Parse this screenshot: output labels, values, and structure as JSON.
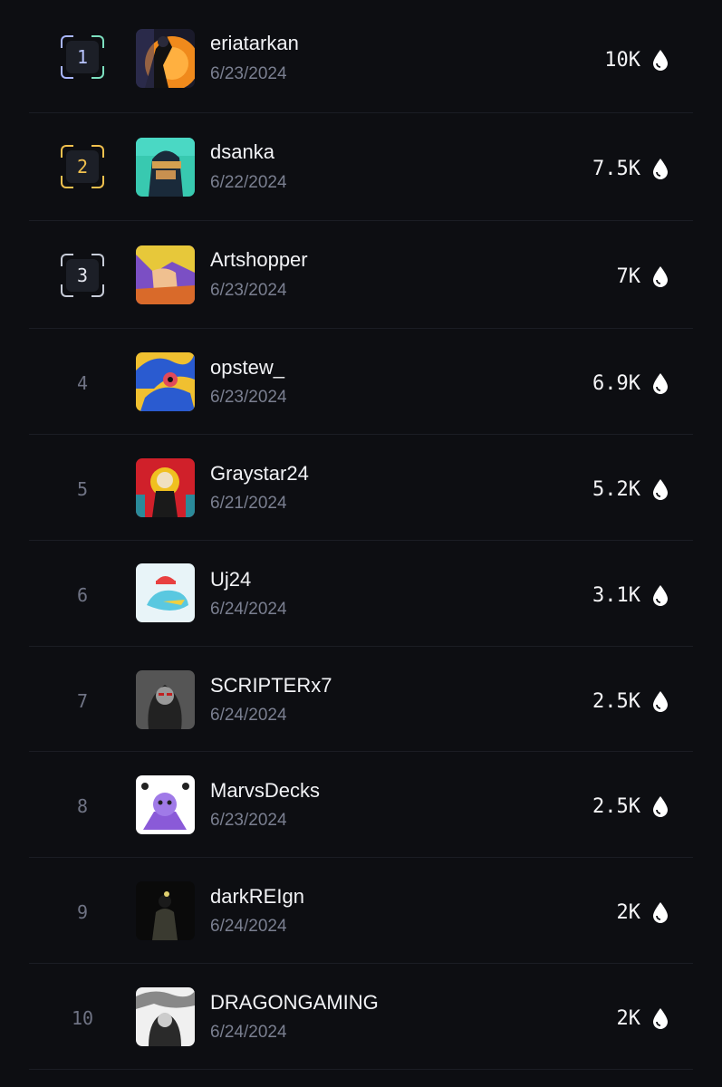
{
  "leaderboard": {
    "entries": [
      {
        "rank": "1",
        "name": "eriatarkan",
        "date": "6/23/2024",
        "score": "10K",
        "badge_color": "#a9b6ff",
        "badge_color2": "#7de0c0",
        "avatar": [
          "#f08a1c",
          "#1a1a2a",
          "#e8c060"
        ]
      },
      {
        "rank": "2",
        "name": "dsanka",
        "date": "6/22/2024",
        "score": "7.5K",
        "badge_color": "#f2c14e",
        "badge_color2": "#f2c14e",
        "avatar": [
          "#38c9b0",
          "#1a2a3a",
          "#d4a050"
        ]
      },
      {
        "rank": "3",
        "name": "Artshopper",
        "date": "6/23/2024",
        "score": "7K",
        "badge_color": "#c7ccd8",
        "badge_color2": "#c7ccd8",
        "avatar": [
          "#e7c83a",
          "#7b4fc4",
          "#d96a2a"
        ]
      },
      {
        "rank": "4",
        "name": "opstew_",
        "date": "6/23/2024",
        "score": "6.9K",
        "avatar": [
          "#f0c030",
          "#2a5bd0",
          "#e04a5a"
        ]
      },
      {
        "rank": "5",
        "name": "Graystar24",
        "date": "6/21/2024",
        "score": "5.2K",
        "avatar": [
          "#d0202a",
          "#1a1a1a",
          "#f0e0c0"
        ]
      },
      {
        "rank": "6",
        "name": "Uj24",
        "date": "6/24/2024",
        "score": "3.1K",
        "avatar": [
          "#e8f4f8",
          "#5ac8e0",
          "#e84040"
        ]
      },
      {
        "rank": "7",
        "name": "SCRIPTERx7",
        "date": "6/24/2024",
        "score": "2.5K",
        "avatar": [
          "#555555",
          "#222222",
          "#999999"
        ]
      },
      {
        "rank": "8",
        "name": "MarvsDecks",
        "date": "6/23/2024",
        "score": "2.5K",
        "avatar": [
          "#ffffff",
          "#8a5ad8",
          "#222222"
        ]
      },
      {
        "rank": "9",
        "name": "darkREIgn",
        "date": "6/24/2024",
        "score": "2K",
        "avatar": [
          "#0a0a0a",
          "#3a3a30",
          "#e0d070"
        ]
      },
      {
        "rank": "10",
        "name": "DRAGONGAMING",
        "date": "6/24/2024",
        "score": "2K",
        "avatar": [
          "#f0f0f0",
          "#2a2a2a",
          "#888888"
        ]
      }
    ],
    "score_icon": "drop-icon"
  }
}
